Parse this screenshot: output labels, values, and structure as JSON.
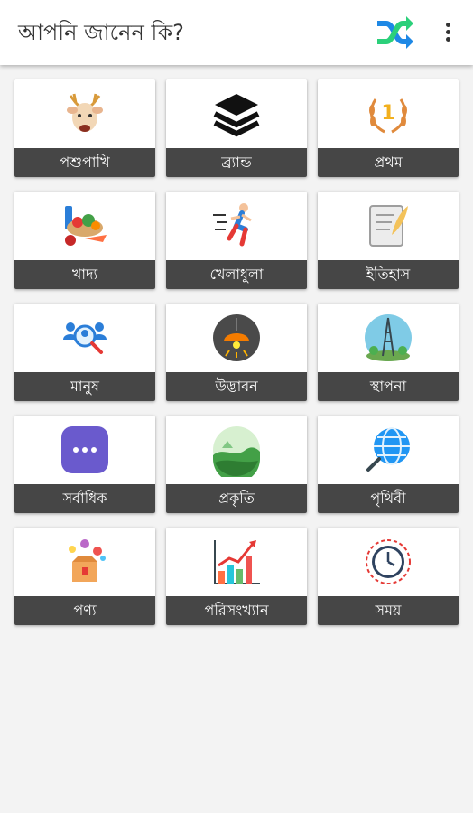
{
  "app": {
    "title": "আপনি জানেন কি?"
  },
  "toolbar": {
    "shuffle_icon": "shuffle-icon",
    "more_icon": "more-vert-icon"
  },
  "colors": {
    "label_bg": "#464646",
    "shuffle_green": "#2bd07a",
    "shuffle_blue": "#1e88e5"
  },
  "categories": [
    {
      "label": "পশুপাখি",
      "icon": "deer-icon"
    },
    {
      "label": "ব্র্যান্ড",
      "icon": "layers-icon"
    },
    {
      "label": "প্রথম",
      "icon": "laurel-first-icon"
    },
    {
      "label": "খাদ্য",
      "icon": "food-icon"
    },
    {
      "label": "খেলাধুলা",
      "icon": "runner-icon"
    },
    {
      "label": "ইতিহাস",
      "icon": "scroll-quill-icon"
    },
    {
      "label": "মানুষ",
      "icon": "people-search-icon"
    },
    {
      "label": "উদ্ভাবন",
      "icon": "lamp-icon"
    },
    {
      "label": "স্থাপনা",
      "icon": "eiffel-tower-icon"
    },
    {
      "label": "সর্বাধিক",
      "icon": "more-dots-icon"
    },
    {
      "label": "প্রকৃতি",
      "icon": "landscape-icon"
    },
    {
      "label": "পৃথিবী",
      "icon": "globe-search-icon"
    },
    {
      "label": "পণ্য",
      "icon": "product-box-icon"
    },
    {
      "label": "পরিসংখ্যান",
      "icon": "bar-chart-icon"
    },
    {
      "label": "সময়",
      "icon": "clock-icon"
    }
  ]
}
